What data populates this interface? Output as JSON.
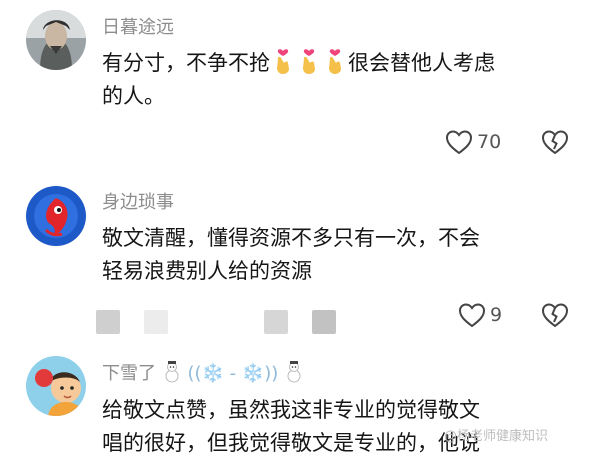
{
  "comments": [
    {
      "username": "日暮途远",
      "text_a": "有分寸，不争不抢",
      "text_b": "很会替他人考虑",
      "text_c": "的人。",
      "emoji": "finger-heart-emoji",
      "likes": "70"
    },
    {
      "username": "身边琐事",
      "text_line1": "敬文清醒，懂得资源不多只有一次，不会",
      "text_line2": "轻易浪费别人给的资源",
      "likes": "9"
    },
    {
      "username_prefix": "下雪了",
      "username_snow": "((❄️ - ❄️))",
      "text_line1": "给敬文点赞，虽然我这非专业的觉得敬文",
      "text_line2": "唱的很好，但我觉得敬文是专业的，他说"
    }
  ],
  "watermark": "@杨老师健康知识",
  "icons": {
    "like": "heart-outline-icon",
    "dislike": "broken-heart-icon"
  }
}
